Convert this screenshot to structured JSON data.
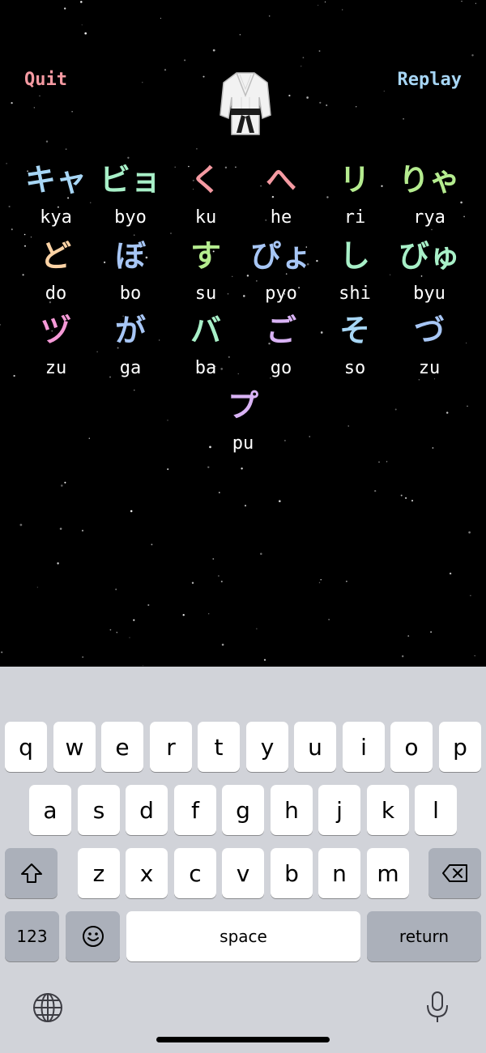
{
  "header": {
    "quit_label": "Quit",
    "replay_label": "Replay"
  },
  "mascot": {
    "icon": "martial-arts-uniform-icon"
  },
  "colors": {
    "background": "#000000",
    "quit": "#f59aa2",
    "replay": "#a7d6f5",
    "keyboard_bg": "#d1d3d9",
    "key": "#ffffff",
    "key_dark": "#abb0ba"
  },
  "cards": [
    {
      "kana": "キャ",
      "romaji": "kya",
      "color": "#a7d6f5"
    },
    {
      "kana": "ビョ",
      "romaji": "byo",
      "color": "#a8f0c8"
    },
    {
      "kana": "く",
      "romaji": "ku",
      "color": "#f59aa2"
    },
    {
      "kana": "へ",
      "romaji": "he",
      "color": "#f59aa2"
    },
    {
      "kana": "リ",
      "romaji": "ri",
      "color": "#b5ec8f"
    },
    {
      "kana": "りゃ",
      "romaji": "rya",
      "color": "#b5ec8f"
    },
    {
      "kana": "ど",
      "romaji": "do",
      "color": "#fcd3a5"
    },
    {
      "kana": "ぼ",
      "romaji": "bo",
      "color": "#a7c6f5"
    },
    {
      "kana": "す",
      "romaji": "su",
      "color": "#b5ec8f"
    },
    {
      "kana": "ぴょ",
      "romaji": "pyo",
      "color": "#a7c6f5"
    },
    {
      "kana": "し",
      "romaji": "shi",
      "color": "#a8f0c8"
    },
    {
      "kana": "びゅ",
      "romaji": "byu",
      "color": "#a8f0c8"
    },
    {
      "kana": "ヅ",
      "romaji": "zu",
      "color": "#f59ad7"
    },
    {
      "kana": "が",
      "romaji": "ga",
      "color": "#a7c6f5"
    },
    {
      "kana": "バ",
      "romaji": "ba",
      "color": "#a8f0c8"
    },
    {
      "kana": "ご",
      "romaji": "go",
      "color": "#d9b3f5"
    },
    {
      "kana": "そ",
      "romaji": "so",
      "color": "#a7d6f5"
    },
    {
      "kana": "づ",
      "romaji": "zu",
      "color": "#a7c6f5"
    },
    {
      "kana": "プ",
      "romaji": "pu",
      "color": "#d9b3f5"
    }
  ],
  "keyboard": {
    "row1": [
      "q",
      "w",
      "e",
      "r",
      "t",
      "y",
      "u",
      "i",
      "o",
      "p"
    ],
    "row2": [
      "a",
      "s",
      "d",
      "f",
      "g",
      "h",
      "j",
      "k",
      "l"
    ],
    "row3": [
      "z",
      "x",
      "c",
      "v",
      "b",
      "n",
      "m"
    ],
    "numbers_label": "123",
    "space_label": "space",
    "return_label": "return",
    "shift_icon": "shift-icon",
    "delete_icon": "delete-icon",
    "emoji_icon": "emoji-icon",
    "globe_icon": "globe-icon",
    "mic_icon": "microphone-icon"
  }
}
